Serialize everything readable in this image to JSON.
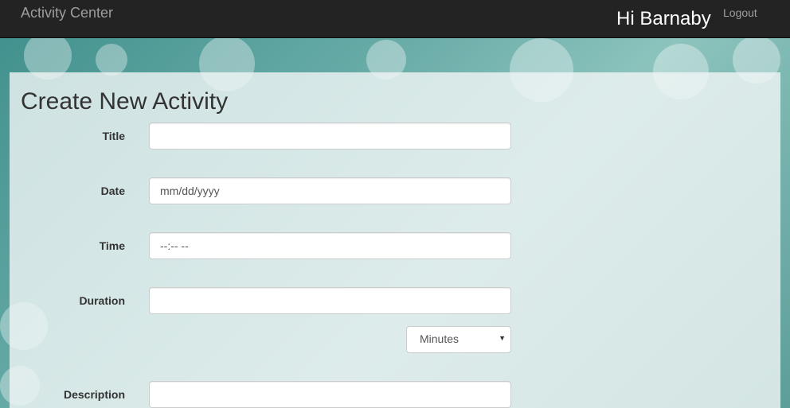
{
  "navbar": {
    "brand": "Activity Center",
    "greeting": "Hi Barnaby",
    "logout": "Logout"
  },
  "page": {
    "title": "Create New Activity"
  },
  "form": {
    "title_label": "Title",
    "title_value": "",
    "date_label": "Date",
    "date_placeholder": "mm/dd/yyyy",
    "time_label": "Time",
    "time_placeholder": "--:-- --",
    "duration_label": "Duration",
    "duration_value": "",
    "duration_unit": "Minutes",
    "description_label": "Description",
    "description_value": ""
  },
  "colors": {
    "navbar_bg": "#222322",
    "brand_text": "#9d9d9d",
    "panel_bg": "#f1f6f6",
    "background_teal": "#5d9e9a"
  },
  "icons": {
    "select_caret": "chevron-down-icon"
  }
}
